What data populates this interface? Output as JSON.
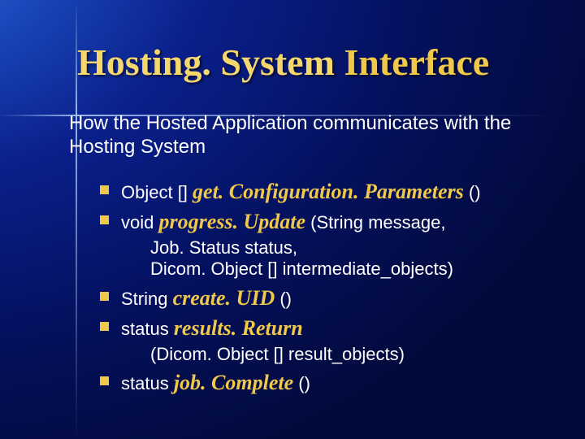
{
  "title_part1": "Hosting. System ",
  "title_part2": "Interface",
  "subtitle": "How the Hosted Application communicates with the Hosting System",
  "items": [
    {
      "ret": "Object [] ",
      "method": "get. Configuration. Parameters",
      "tail": " ()"
    },
    {
      "ret": "void ",
      "method": "progress. Update",
      "tail": " (String message,"
    }
  ],
  "params1_line1": "Job. Status status,",
  "params1_line2": "Dicom. Object [] intermediate_objects)",
  "items2": [
    {
      "ret": "String ",
      "method": "create. UID",
      "tail": " ()"
    },
    {
      "ret": "status ",
      "method": "results. Return",
      "tail": ""
    }
  ],
  "params2_line1": "(Dicom. Object [] result_objects)",
  "items3": [
    {
      "ret": "status ",
      "method": "job. Complete",
      "tail": " ()"
    }
  ]
}
